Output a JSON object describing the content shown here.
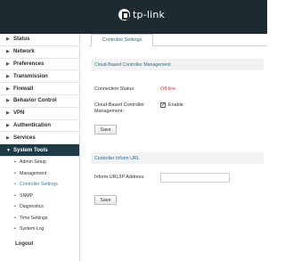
{
  "brand": {
    "name": "tp-link"
  },
  "sidebar": {
    "items": [
      {
        "label": "Status"
      },
      {
        "label": "Network"
      },
      {
        "label": "Preferences"
      },
      {
        "label": "Transmission"
      },
      {
        "label": "Firewall"
      },
      {
        "label": "Behavior Control"
      },
      {
        "label": "VPN"
      },
      {
        "label": "Authentication"
      },
      {
        "label": "Services"
      },
      {
        "label": "System Tools",
        "expanded": true
      }
    ],
    "subitems": [
      {
        "label": "Admin Setup"
      },
      {
        "label": "Management"
      },
      {
        "label": "Controller Settings",
        "active": true
      },
      {
        "label": "SNMP"
      },
      {
        "label": "Diagnostics"
      },
      {
        "label": "Time Settings"
      },
      {
        "label": "System Log"
      }
    ],
    "logout": "Logout"
  },
  "main": {
    "tab": "Controller Settings",
    "cloud_section": {
      "title": "Cloud-Based Controller Management",
      "connection_status_label": "Connection Status:",
      "connection_status_value": "Off-line",
      "cbcm_label_line1": "Cloud-Based Controller",
      "cbcm_label_line2": "Management:",
      "enable_label": "Enable",
      "enable_checked": true,
      "save_label": "Save"
    },
    "inform_section": {
      "title": "Controller Inform URL",
      "url_label": "Inform URL/IP Address:",
      "url_value": "",
      "save_label": "Save"
    }
  },
  "colors": {
    "header_bg": "#1d2a30",
    "active_nav_bg": "#1f3a47",
    "accent_text": "#2b6a8c",
    "status_offline": "#d9342b"
  }
}
